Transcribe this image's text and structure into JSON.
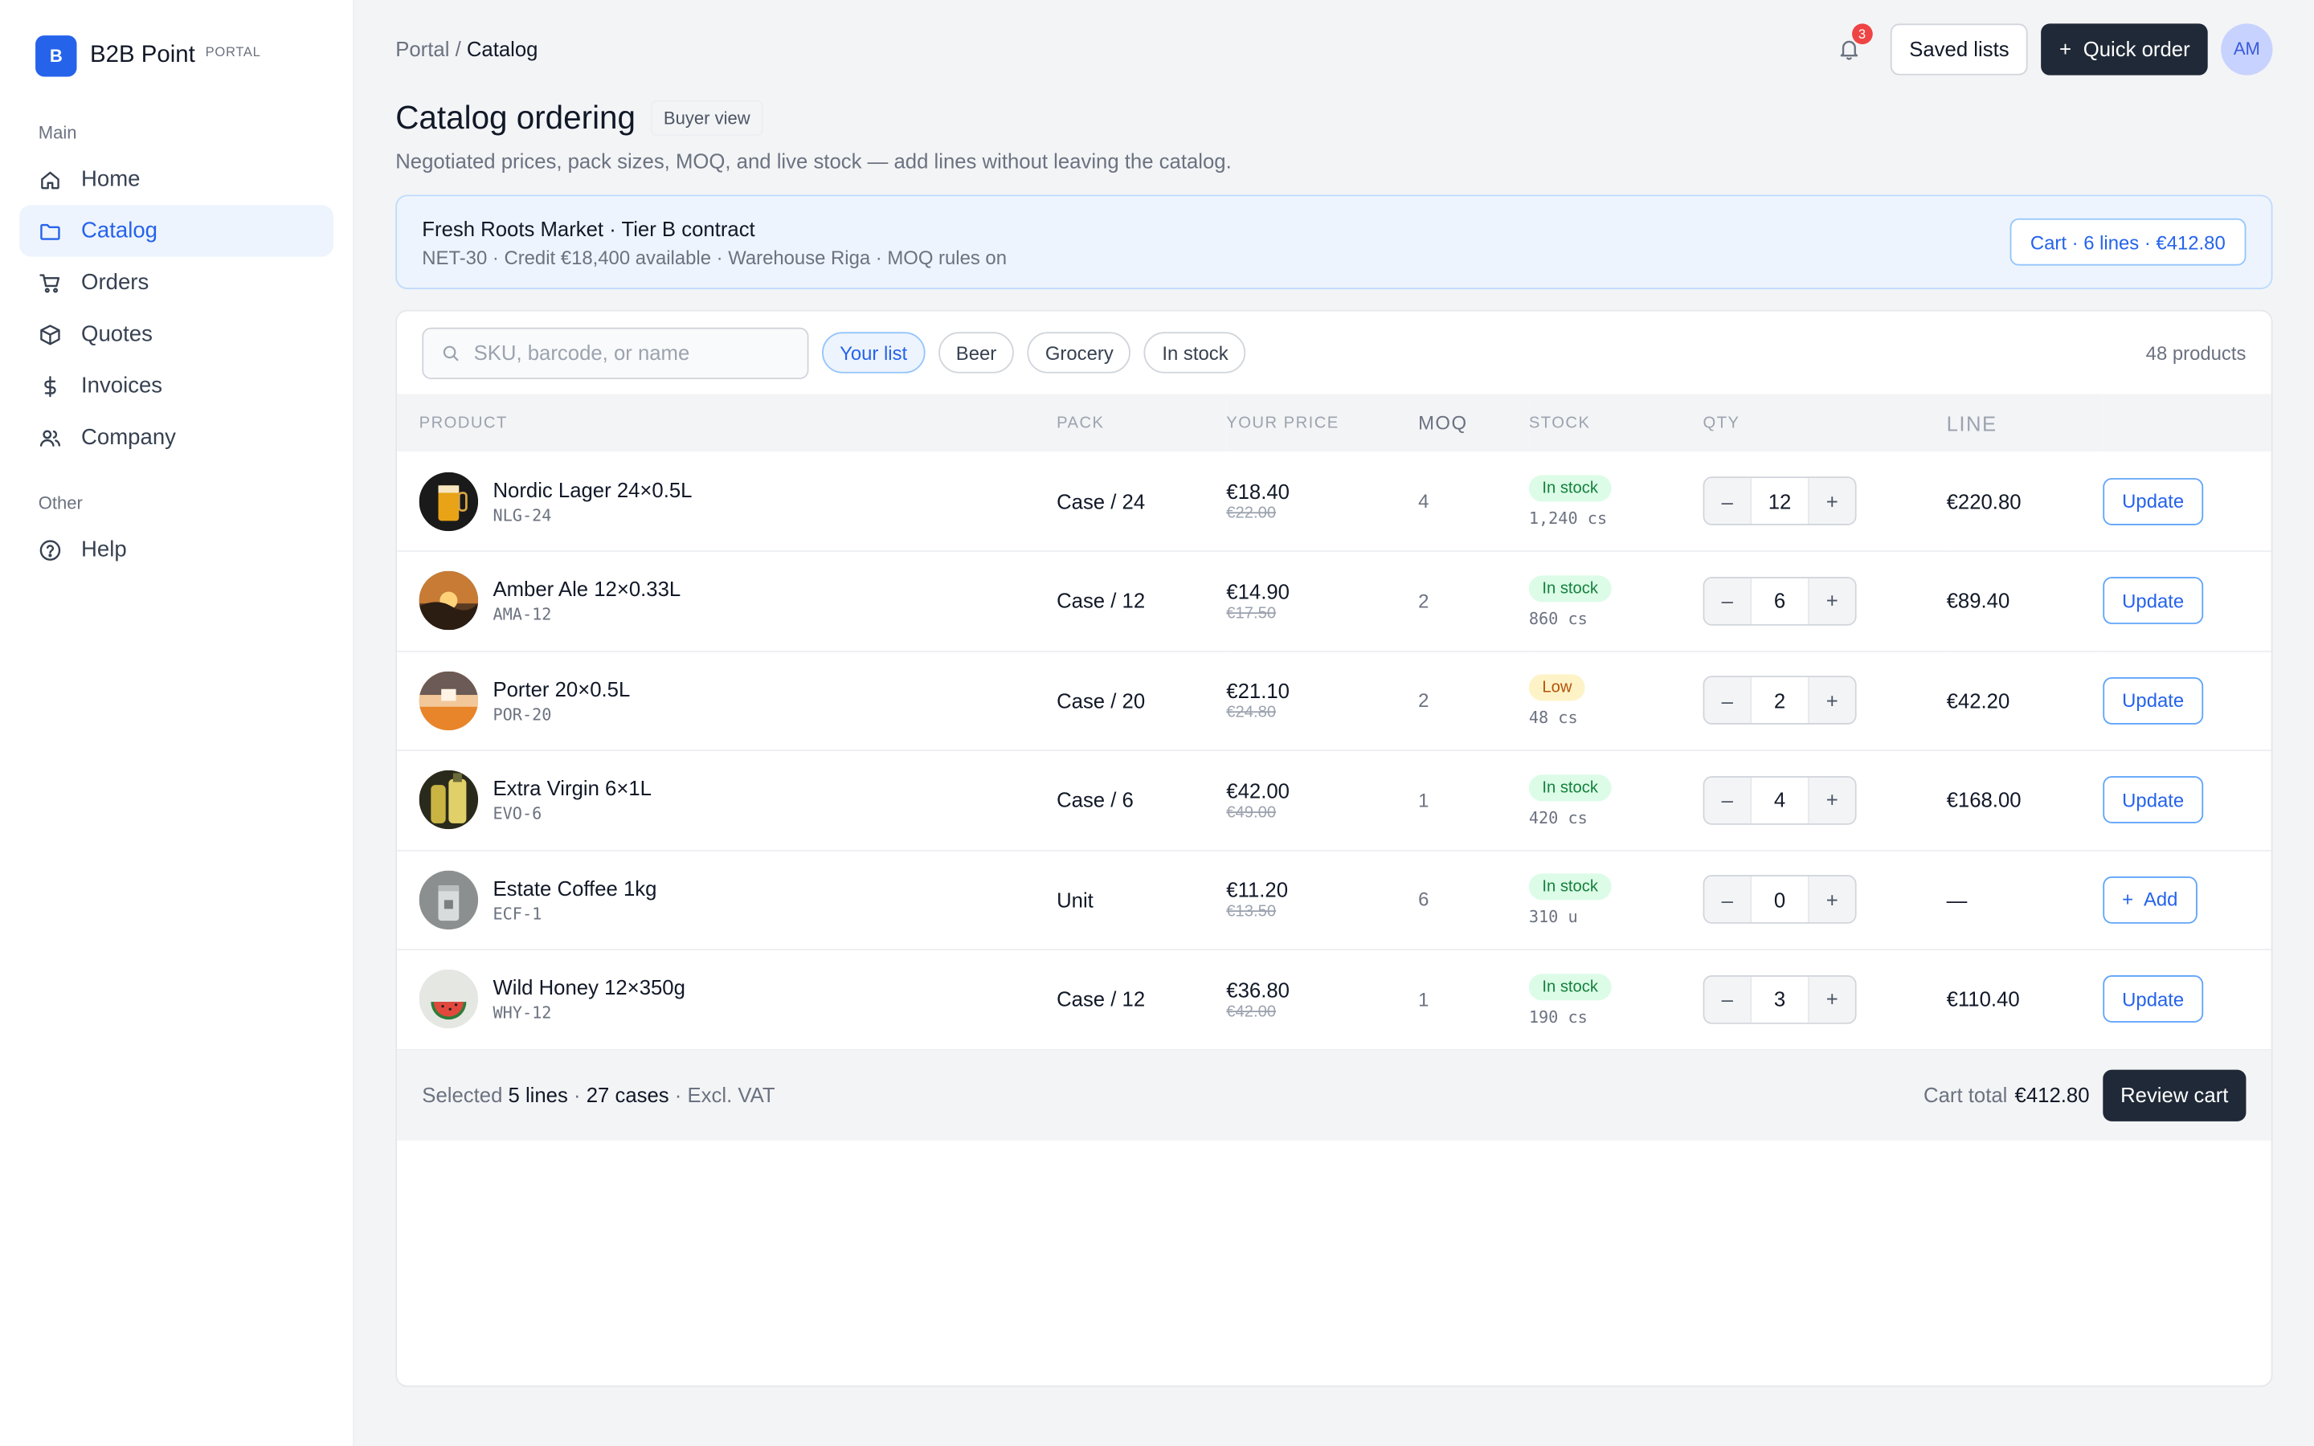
{
  "brand": {
    "logo_letter": "B",
    "name": "B2B Point",
    "tag": "PORTAL"
  },
  "sidebar": {
    "main_label": "Main",
    "other_label": "Other",
    "items": [
      {
        "label": "Home",
        "icon": "home-icon"
      },
      {
        "label": "Catalog",
        "icon": "folder-icon",
        "active": true
      },
      {
        "label": "Orders",
        "icon": "cart-icon"
      },
      {
        "label": "Quotes",
        "icon": "box-icon"
      },
      {
        "label": "Invoices",
        "icon": "currency-icon"
      },
      {
        "label": "Company",
        "icon": "users-icon"
      }
    ],
    "other_items": [
      {
        "label": "Help",
        "icon": "help-icon"
      }
    ]
  },
  "header": {
    "breadcrumb_root": "Portal",
    "breadcrumb_sep": "/",
    "breadcrumb_current": "Catalog",
    "notifications": "3",
    "saved_lists": "Saved lists",
    "quick_order": "Quick order",
    "avatar_initials": "AM"
  },
  "page": {
    "title": "Catalog ordering",
    "view_badge": "Buyer view",
    "subtitle": "Negotiated prices, pack sizes, MOQ, and live stock — add lines without leaving the catalog."
  },
  "contract": {
    "title": "Fresh Roots Market · Tier B contract",
    "details": "NET-30 · Credit €18,400 available · Warehouse Riga · MOQ rules on",
    "cart_button": "Cart · 6 lines · €412.80"
  },
  "filters": {
    "search_placeholder": "SKU, barcode, or name",
    "chips": [
      "Your list",
      "Beer",
      "Grocery",
      "In stock"
    ],
    "active_chip": "Your list",
    "count": "48 products"
  },
  "table": {
    "columns": [
      "PRODUCT",
      "PACK",
      "YOUR PRICE",
      "MOQ",
      "STOCK",
      "QTY",
      "LINE"
    ],
    "rows": [
      {
        "name": "Nordic Lager 24×0.5L",
        "sku": "NLG-24",
        "pack": "Case / 24",
        "price": "€18.40",
        "list_price": "€22.00",
        "moq": "4",
        "stock_status": "In stock",
        "stock_level": "ok",
        "stock_qty": "1,240 cs",
        "qty": "12",
        "line": "€220.80",
        "action": "Update"
      },
      {
        "name": "Amber Ale 12×0.33L",
        "sku": "AMA-12",
        "pack": "Case / 12",
        "price": "€14.90",
        "list_price": "€17.50",
        "moq": "2",
        "stock_status": "In stock",
        "stock_level": "ok",
        "stock_qty": "860 cs",
        "qty": "6",
        "line": "€89.40",
        "action": "Update"
      },
      {
        "name": "Porter 20×0.5L",
        "sku": "POR-20",
        "pack": "Case / 20",
        "price": "€21.10",
        "list_price": "€24.80",
        "moq": "2",
        "stock_status": "Low",
        "stock_level": "low",
        "stock_qty": "48 cs",
        "qty": "2",
        "line": "€42.20",
        "action": "Update"
      },
      {
        "name": "Extra Virgin 6×1L",
        "sku": "EVO-6",
        "pack": "Case / 6",
        "price": "€42.00",
        "list_price": "€49.00",
        "moq": "1",
        "stock_status": "In stock",
        "stock_level": "ok",
        "stock_qty": "420 cs",
        "qty": "4",
        "line": "€168.00",
        "action": "Update"
      },
      {
        "name": "Estate Coffee 1kg",
        "sku": "ECF-1",
        "pack": "Unit",
        "price": "€11.20",
        "list_price": "€13.50",
        "moq": "6",
        "stock_status": "In stock",
        "stock_level": "ok",
        "stock_qty": "310 u",
        "qty": "0",
        "line": "—",
        "action": "Add"
      },
      {
        "name": "Wild Honey 12×350g",
        "sku": "WHY-12",
        "pack": "Case / 12",
        "price": "€36.80",
        "list_price": "€42.00",
        "moq": "1",
        "stock_status": "In stock",
        "stock_level": "ok",
        "stock_qty": "190 cs",
        "qty": "3",
        "line": "€110.40",
        "action": "Update"
      }
    ],
    "minus": "–",
    "plus": "+"
  },
  "footer": {
    "selected_prefix": "Selected",
    "lines": "5 lines",
    "sep": "·",
    "cases": "27 cases",
    "vat": "· Excl. VAT",
    "total_label": "Cart total",
    "total_value": "€412.80",
    "review": "Review cart"
  },
  "colors": {
    "accent": "#2563eb",
    "dark": "#1f2937",
    "success": "#15803d",
    "warning": "#b45309",
    "danger": "#ef4444"
  }
}
